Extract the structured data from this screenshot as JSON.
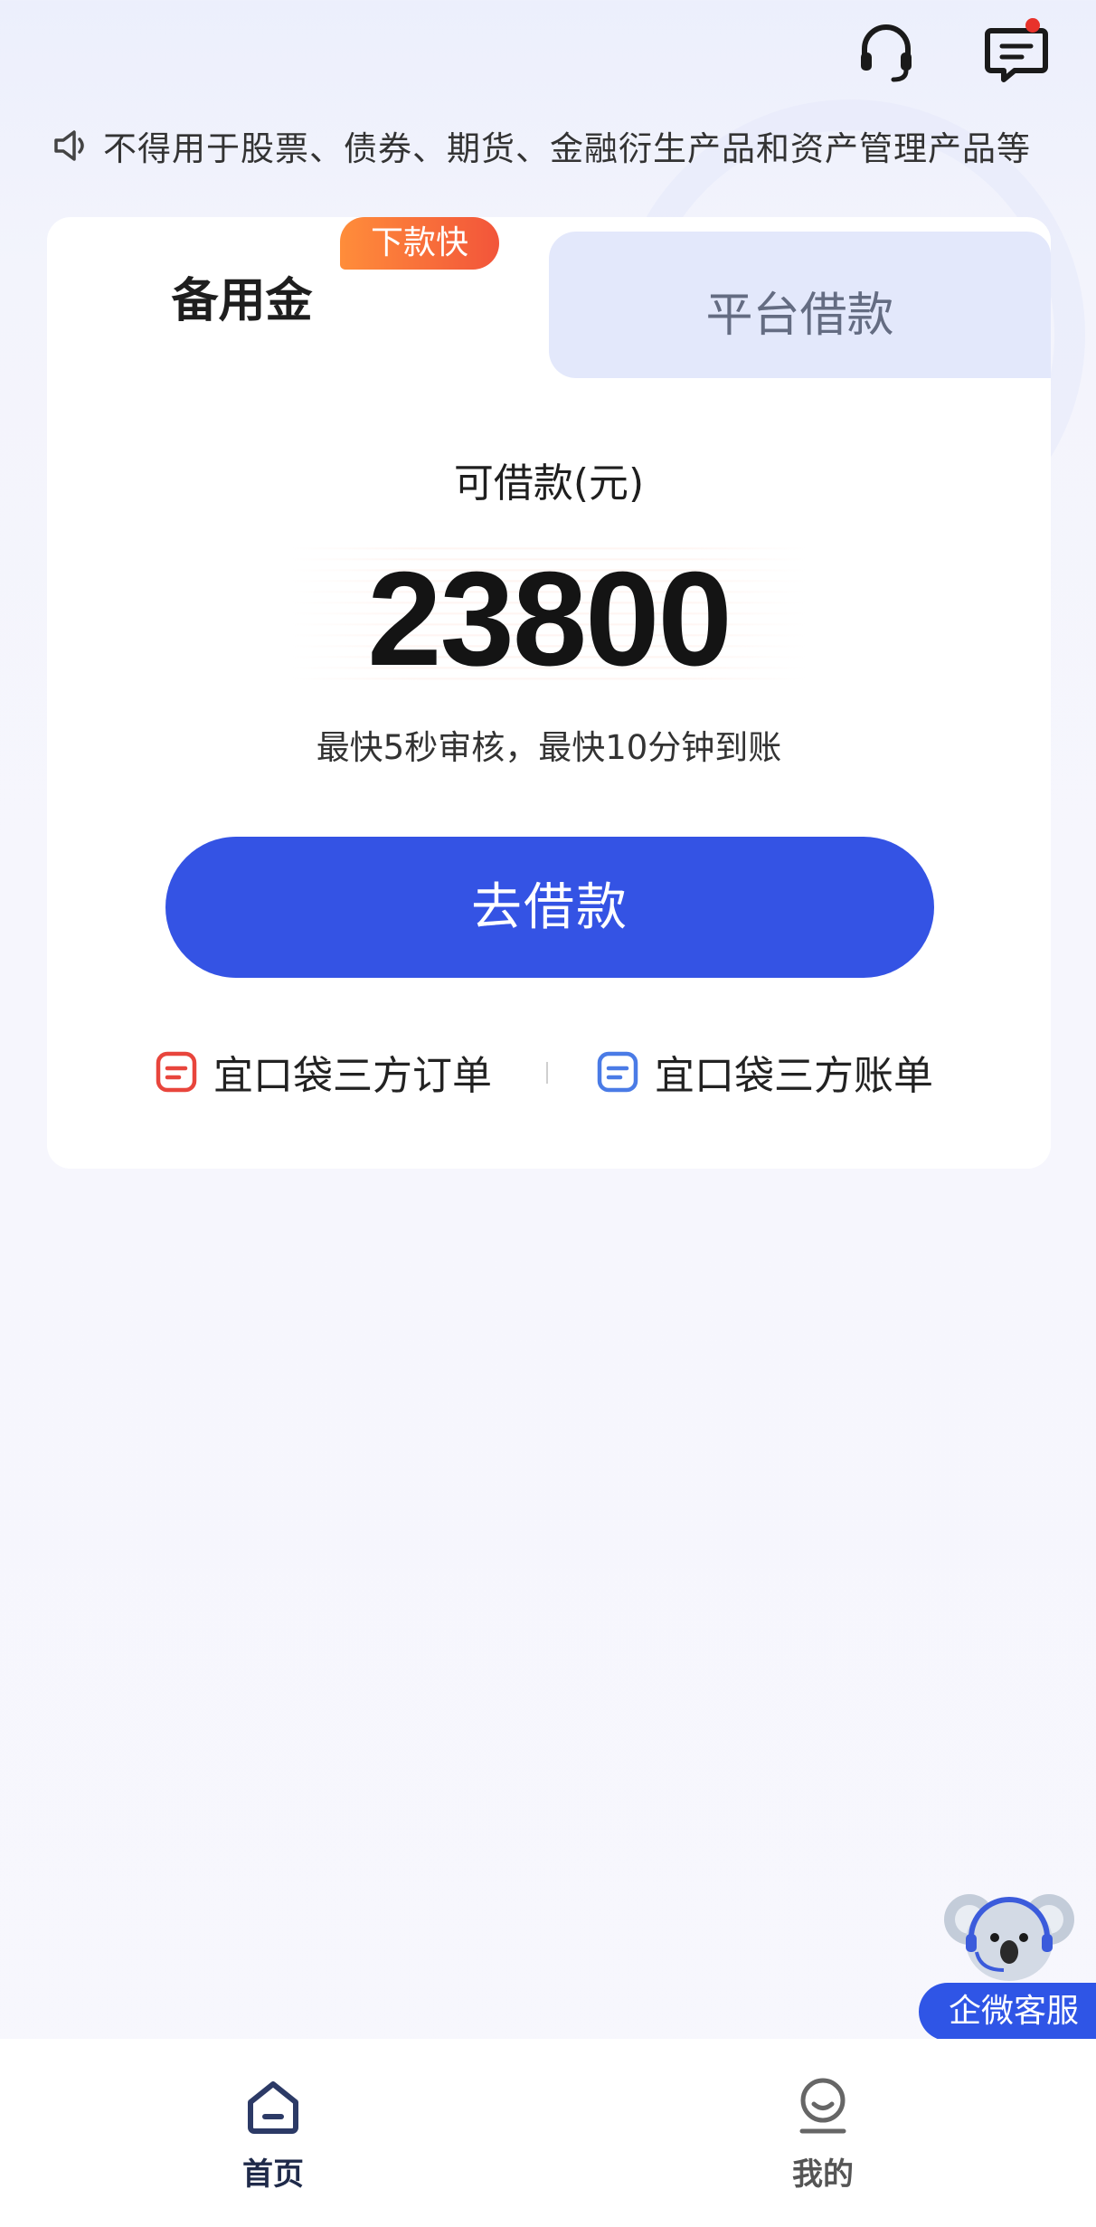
{
  "header": {
    "service_icon": "headset-icon",
    "message_icon": "message-icon",
    "message_unread": true,
    "unread_dot_color": "#e8322b"
  },
  "notice": {
    "icon": "speaker-icon",
    "text": "不得用于股票、债券、期货、金融衍生产品和资产管理产品等"
  },
  "tabs": [
    {
      "label": "备用金",
      "active": true,
      "badge": "下款快"
    },
    {
      "label": "平台借款",
      "active": false
    }
  ],
  "loan": {
    "amount_label": "可借款(元)",
    "amount": "23800",
    "speed_text": "最快5秒审核，最快10分钟到账",
    "button_label": "去借款"
  },
  "links": [
    {
      "label": "宜口袋三方订单",
      "icon": "document-icon",
      "color": "#e8453c"
    },
    {
      "label": "宜口袋三方账单",
      "icon": "document-icon",
      "color": "#4a7be6"
    }
  ],
  "float_service": {
    "label": "企微客服",
    "icon": "koala-icon"
  },
  "bottom_nav": [
    {
      "label": "首页",
      "icon": "home-icon",
      "active": true
    },
    {
      "label": "我的",
      "icon": "profile-icon",
      "active": false
    }
  ],
  "colors": {
    "primary": "#3453e4",
    "badge_start": "#ff8d3a",
    "badge_end": "#f2553a",
    "tab_inactive_bg": "#e3e8fb"
  }
}
